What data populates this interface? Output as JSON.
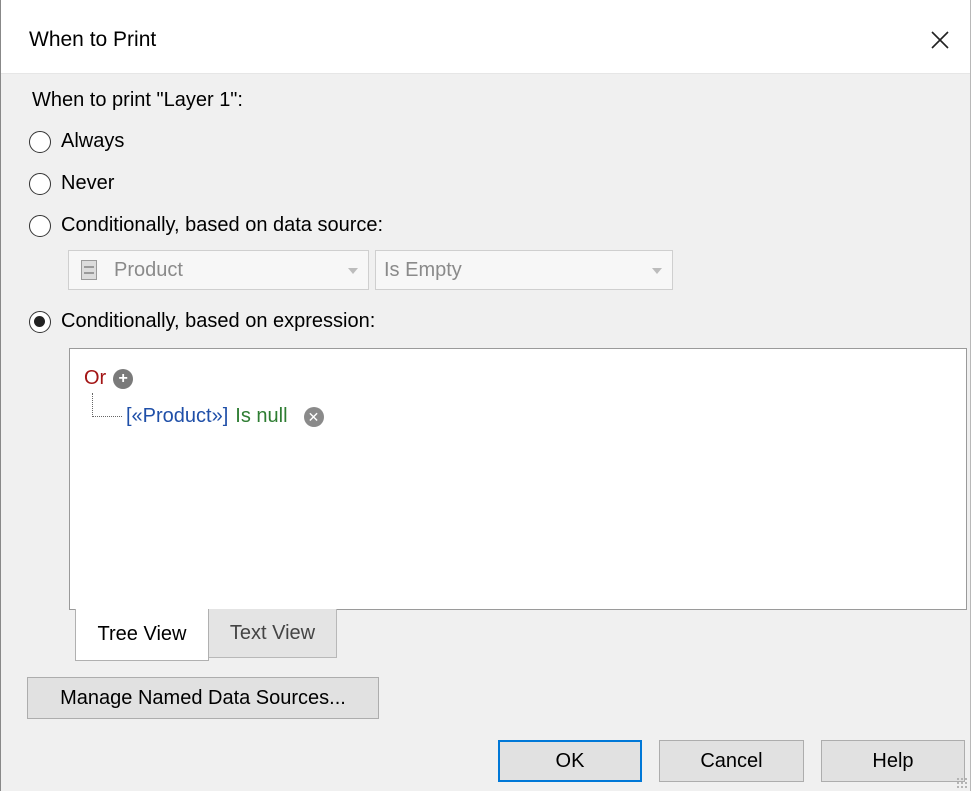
{
  "window": {
    "title": "When to Print"
  },
  "prompt": "When to print \"Layer 1\":",
  "options": [
    {
      "label": "Always",
      "checked": false
    },
    {
      "label": "Never",
      "checked": false
    },
    {
      "label": "Conditionally, based on data source:",
      "checked": false
    },
    {
      "label": "Conditionally, based on expression:",
      "checked": true
    }
  ],
  "data_source": {
    "field_value": "Product",
    "field_icon": "data-source-icon",
    "condition_value": "Is Empty",
    "enabled": false
  },
  "expression": {
    "operator": "Or",
    "add_icon": "plus-circle-icon",
    "conditions": [
      {
        "field": "[«Product»]",
        "operator": "Is null",
        "remove_icon": "remove-circle-icon"
      }
    ]
  },
  "tabs": [
    {
      "label": "Tree View",
      "active": true
    },
    {
      "label": "Text View",
      "active": false
    }
  ],
  "buttons": {
    "manage": "Manage Named Data Sources...",
    "ok": "OK",
    "cancel": "Cancel",
    "help": "Help"
  },
  "colors": {
    "or_operator": "#a31515",
    "field": "#1f4fa8",
    "condition_operator": "#2e7d32",
    "default_button_border": "#0078d7"
  }
}
